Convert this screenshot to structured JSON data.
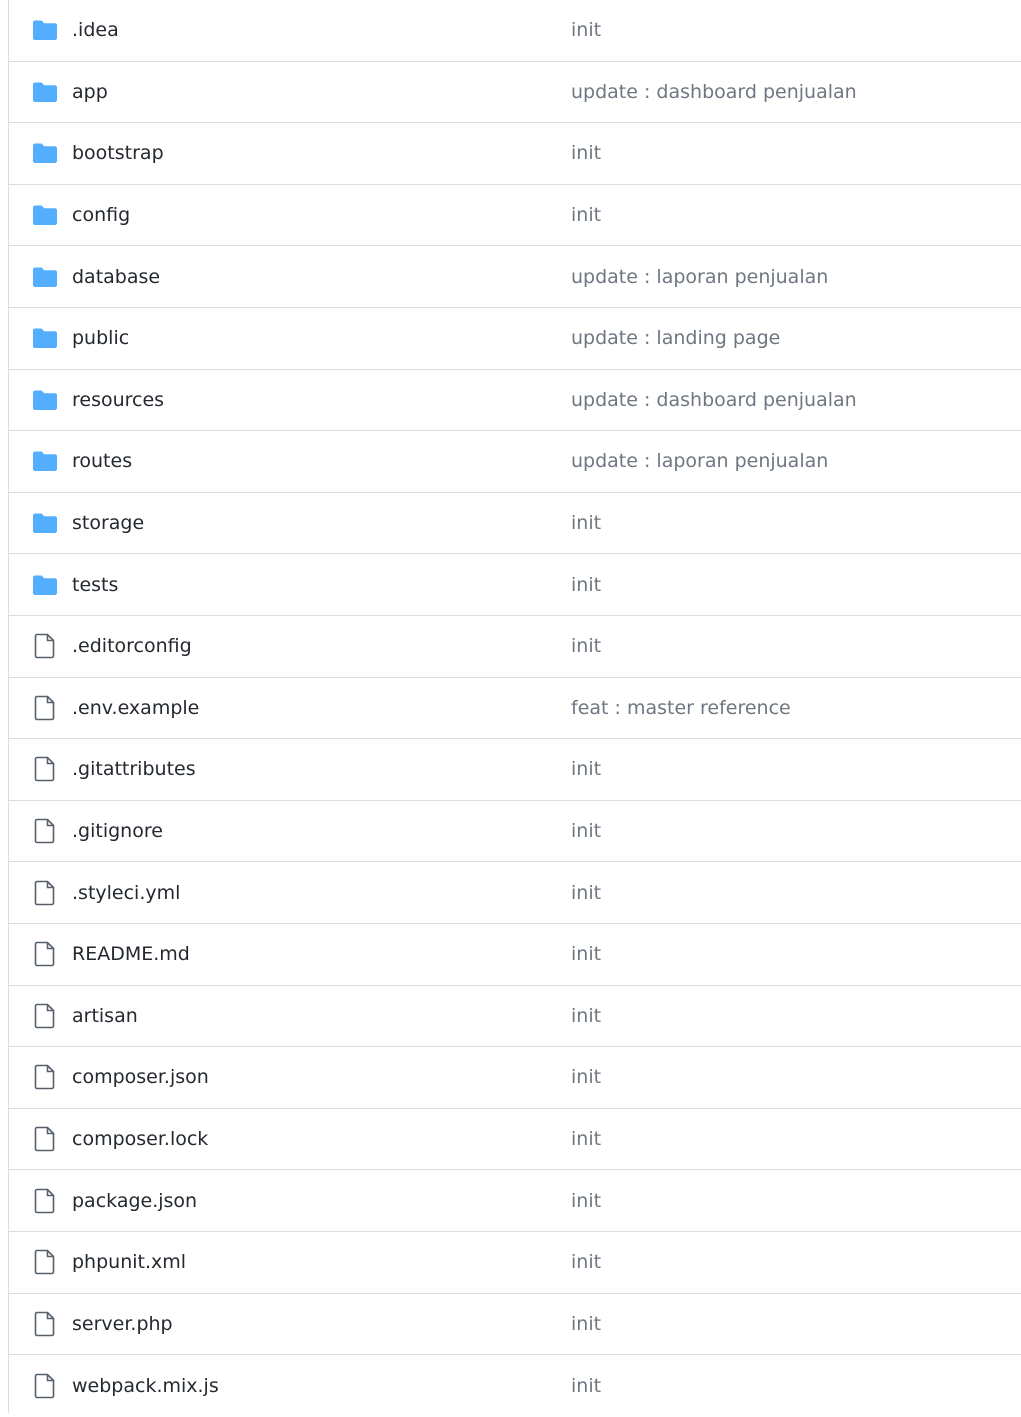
{
  "colors": {
    "folder": "#54aeff",
    "file_icon": "#57606a",
    "divider": "#d8dee4",
    "commit_text": "#6e7781",
    "name_text": "#24292f"
  },
  "entries": [
    {
      "name": ".idea",
      "type": "folder",
      "icon": "folder-icon",
      "commit": "init"
    },
    {
      "name": "app",
      "type": "folder",
      "icon": "folder-icon",
      "commit": "update : dashboard penjualan"
    },
    {
      "name": "bootstrap",
      "type": "folder",
      "icon": "folder-icon",
      "commit": "init"
    },
    {
      "name": "config",
      "type": "folder",
      "icon": "folder-icon",
      "commit": "init"
    },
    {
      "name": "database",
      "type": "folder",
      "icon": "folder-icon",
      "commit": "update : laporan penjualan"
    },
    {
      "name": "public",
      "type": "folder",
      "icon": "folder-icon",
      "commit": "update : landing page"
    },
    {
      "name": "resources",
      "type": "folder",
      "icon": "folder-icon",
      "commit": "update : dashboard penjualan"
    },
    {
      "name": "routes",
      "type": "folder",
      "icon": "folder-icon",
      "commit": "update : laporan penjualan"
    },
    {
      "name": "storage",
      "type": "folder",
      "icon": "folder-icon",
      "commit": "init"
    },
    {
      "name": "tests",
      "type": "folder",
      "icon": "folder-icon",
      "commit": "init"
    },
    {
      "name": ".editorconfig",
      "type": "file",
      "icon": "file-icon",
      "commit": "init"
    },
    {
      "name": ".env.example",
      "type": "file",
      "icon": "file-icon",
      "commit": "feat : master reference"
    },
    {
      "name": ".gitattributes",
      "type": "file",
      "icon": "file-icon",
      "commit": "init"
    },
    {
      "name": ".gitignore",
      "type": "file",
      "icon": "file-icon",
      "commit": "init"
    },
    {
      "name": ".styleci.yml",
      "type": "file",
      "icon": "file-icon",
      "commit": "init"
    },
    {
      "name": "README.md",
      "type": "file",
      "icon": "file-icon",
      "commit": "init"
    },
    {
      "name": "artisan",
      "type": "file",
      "icon": "file-icon",
      "commit": "init"
    },
    {
      "name": "composer.json",
      "type": "file",
      "icon": "file-icon",
      "commit": "init"
    },
    {
      "name": "composer.lock",
      "type": "file",
      "icon": "file-icon",
      "commit": "init"
    },
    {
      "name": "package.json",
      "type": "file",
      "icon": "file-icon",
      "commit": "init"
    },
    {
      "name": "phpunit.xml",
      "type": "file",
      "icon": "file-icon",
      "commit": "init"
    },
    {
      "name": "server.php",
      "type": "file",
      "icon": "file-icon",
      "commit": "init"
    },
    {
      "name": "webpack.mix.js",
      "type": "file",
      "icon": "file-icon",
      "commit": "init"
    }
  ]
}
